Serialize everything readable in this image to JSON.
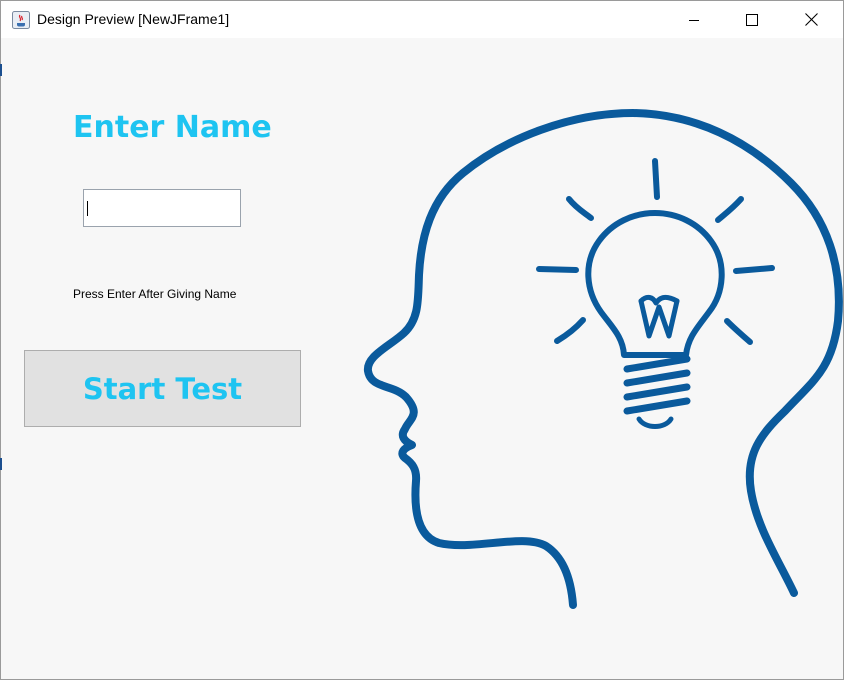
{
  "window": {
    "title": "Design Preview [NewJFrame1]",
    "controls": [
      "minimize",
      "maximize",
      "close"
    ]
  },
  "form": {
    "heading": "Enter Name",
    "name_input": {
      "value": "",
      "placeholder": ""
    },
    "hint": "Press Enter After Giving Name",
    "start_button": "Start Test"
  },
  "illustration": {
    "icon": "head-with-lightbulb-icon"
  },
  "colors": {
    "accent": "#1ec4f1",
    "illustration": "#0a5a9c",
    "panel": "#f7f7f7",
    "button": "#e1e1e1"
  }
}
